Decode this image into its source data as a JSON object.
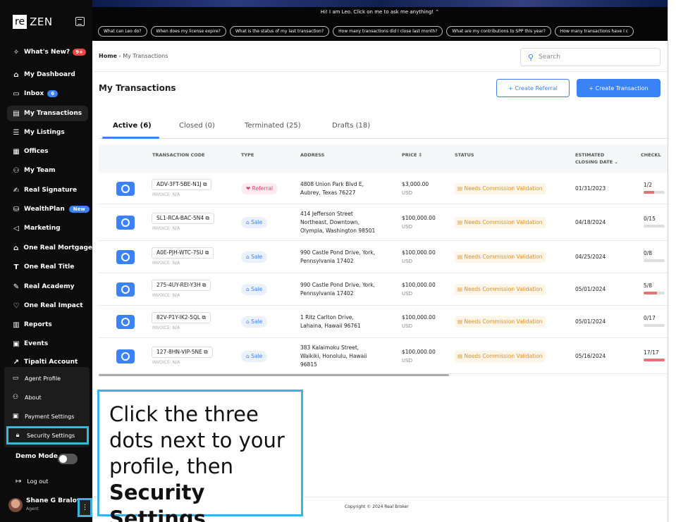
{
  "sidebar": {
    "logo_box": "re",
    "logo_text": "ZEN",
    "items": [
      {
        "label": "What's New?",
        "icon": "sparkle-icon",
        "glyph": "✧",
        "badge": "9+"
      },
      {
        "label": "My Dashboard",
        "icon": "home-icon",
        "glyph": "⌂"
      },
      {
        "label": "Inbox",
        "icon": "inbox-icon",
        "glyph": "▭",
        "badge": "6"
      },
      {
        "label": "My Transactions",
        "icon": "clipboard-icon",
        "glyph": "▤"
      },
      {
        "label": "My Listings",
        "icon": "list-icon",
        "glyph": "☰"
      },
      {
        "label": "Offices",
        "icon": "building-icon",
        "glyph": "▦"
      },
      {
        "label": "My Team",
        "icon": "team-icon",
        "glyph": "⚇"
      },
      {
        "label": "Real Signature",
        "icon": "signature-icon",
        "glyph": "✍"
      },
      {
        "label": "WealthPlan",
        "icon": "wealth-icon",
        "glyph": "⛁",
        "badge": "New"
      },
      {
        "label": "Marketing",
        "icon": "megaphone-icon",
        "glyph": "◁"
      },
      {
        "label": "One Real Mortgage",
        "icon": "mortgage-icon",
        "glyph": "⌂"
      },
      {
        "label": "One Real Title",
        "icon": "title-icon",
        "glyph": "T"
      },
      {
        "label": "Real Academy",
        "icon": "academy-icon",
        "glyph": "✎"
      },
      {
        "label": "One Real Impact",
        "icon": "impact-icon",
        "glyph": "♡"
      },
      {
        "label": "Reports",
        "icon": "reports-icon",
        "glyph": "▥"
      },
      {
        "label": "Events",
        "icon": "calendar-icon",
        "glyph": "▣"
      },
      {
        "label": "Tipalti Account",
        "icon": "external-link-icon",
        "glyph": "↗"
      }
    ],
    "submenu": [
      {
        "label": "Agent Profile",
        "icon": "id-card-icon",
        "glyph": "▭"
      },
      {
        "label": "About",
        "icon": "people-icon",
        "glyph": "⚇"
      },
      {
        "label": "Payment Settings",
        "icon": "payment-icon",
        "glyph": "▣"
      },
      {
        "label": "Security Settings",
        "icon": "lock-icon",
        "glyph": "🔒︎"
      }
    ],
    "demo_mode": "Demo Mode",
    "logout": "Log out",
    "user_name": "Shane G Bralove",
    "user_role": "Agent"
  },
  "banner": {
    "title": "Hi! I am Leo. Click on me to ask me anything! ⌃",
    "chips": [
      "What can Leo do?",
      "When does my license expire?",
      "What is the status of my last transaction?",
      "How many transactions did I close last month?",
      "What are my contributions to SPP this year?",
      "How many transactions have I c"
    ]
  },
  "header": {
    "breadcrumb_home": "Home",
    "breadcrumb_sep": "›",
    "breadcrumb_current": "My Transactions",
    "search_placeholder": "Search",
    "page_title": "My Transactions",
    "create_referral": "+ Create Referral",
    "create_transaction": "+ Create Transaction"
  },
  "tabs": [
    {
      "label": "Active (6)"
    },
    {
      "label": "Closed (0)"
    },
    {
      "label": "Terminated (25)"
    },
    {
      "label": "Drafts (18)"
    }
  ],
  "columns": {
    "code": "TRANSACTION CODE",
    "type": "TYPE",
    "address": "ADDRESS",
    "price": "PRICE ⇕",
    "status": "STATUS",
    "closing_line1": "ESTIMATED",
    "closing_line2": "CLOSING DATE  ⌄",
    "checklist": "CHECKL"
  },
  "rows": [
    {
      "code": "ADV-3FT-5BE-N1J",
      "invoice": "INVOICE: N/A",
      "type": "Referral",
      "address": [
        "4808 Union Park Blvd E,",
        "Aubrey, Texas 76227"
      ],
      "price": "$3,000.00",
      "currency": "USD",
      "status": "Needs Commission Validation",
      "closing": "01/31/2023",
      "checklist": "1/2",
      "progress": 0.5
    },
    {
      "code": "SL1-RCA-BAC-5N4",
      "invoice": "INVOICE: N/A",
      "type": "Sale",
      "address": [
        "414 Jefferson Street",
        "Northeast, Downtown,",
        "Olympia, Washington 98501"
      ],
      "price": "$100,000.00",
      "currency": "USD",
      "status": "Needs Commission Validation",
      "closing": "04/18/2024",
      "checklist": "0/15",
      "progress": 0
    },
    {
      "code": "A0E-PJH-WTC-7SU",
      "invoice": "INVOICE: N/A",
      "type": "Sale",
      "address": [
        "990 Castle Pond Drive, York,",
        "Pennsylvania 17402"
      ],
      "price": "$100,000.00",
      "currency": "USD",
      "status": "Needs Commission Validation",
      "closing": "04/25/2024",
      "checklist": "0/8",
      "progress": 0
    },
    {
      "code": "275-4UY-REI-Y3H",
      "invoice": "INVOICE: N/A",
      "type": "Sale",
      "address": [
        "990 Castle Pond Drive, York,",
        "Pennsylvania 17402"
      ],
      "price": "$100,000.00",
      "currency": "USD",
      "status": "Needs Commission Validation",
      "closing": "05/01/2024",
      "checklist": "5/8",
      "progress": 0.625
    },
    {
      "code": "82V-P1Y-IK2-5QL",
      "invoice": "INVOICE: N/A",
      "type": "Sale",
      "address": [
        "1 Ritz Carlton Drive,",
        "Lahaina, Hawaii 96761"
      ],
      "price": "$100,000.00",
      "currency": "USD",
      "status": "Needs Commission Validation",
      "closing": "05/01/2024",
      "checklist": "0/17",
      "progress": 0
    },
    {
      "code": "127-8HN-VIP-5NE",
      "invoice": "INVOICE: N/A",
      "type": "Sale",
      "address": [
        "383 Kalaimoku Street,",
        "Waikiki, Honolulu, Hawaii",
        "96815"
      ],
      "price": "$100,000.00",
      "currency": "USD",
      "status": "Needs Commission Validation",
      "closing": "05/16/2024",
      "checklist": "17/17",
      "progress": 1
    }
  ],
  "footer": {
    "copyright": "Copyright © 2024 Real Broker"
  },
  "callout": {
    "line1": "Click the three",
    "line2": "dots next to your",
    "line3": "profile, then",
    "bold": "Security Settings"
  },
  "colors": {
    "accent": "#3b82f6",
    "callout_border": "#3bb4e0",
    "status_text": "#d9902b",
    "referral": "#e0426e"
  }
}
